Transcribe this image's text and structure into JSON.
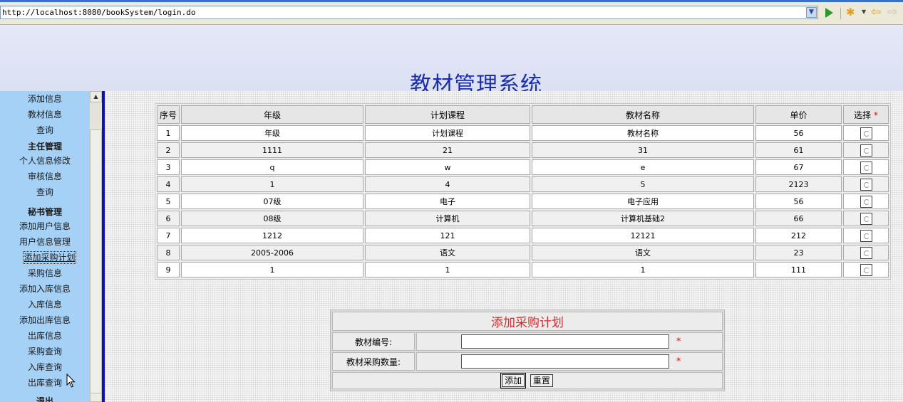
{
  "browser": {
    "url": "http://localhost:8080/bookSystem/login.do"
  },
  "header": {
    "title": "教材管理系统"
  },
  "sidebar": {
    "items": [
      {
        "label": "添加信息",
        "type": "link"
      },
      {
        "label": "教材信息",
        "type": "link"
      },
      {
        "label": "查询",
        "type": "link"
      },
      {
        "label": "主任管理",
        "type": "heading"
      },
      {
        "label": "个人信息修改",
        "type": "link"
      },
      {
        "label": "审核信息",
        "type": "link"
      },
      {
        "label": "查询",
        "type": "link"
      },
      {
        "label": "秘书管理",
        "type": "heading"
      },
      {
        "label": "添加用户信息",
        "type": "link"
      },
      {
        "label": "用户信息管理",
        "type": "link"
      },
      {
        "label": "添加采购计划",
        "type": "link",
        "selected": true
      },
      {
        "label": "采购信息",
        "type": "link"
      },
      {
        "label": "添加入库信息",
        "type": "link"
      },
      {
        "label": "入库信息",
        "type": "link"
      },
      {
        "label": "添加出库信息",
        "type": "link"
      },
      {
        "label": "出库信息",
        "type": "link"
      },
      {
        "label": "采购查询",
        "type": "link"
      },
      {
        "label": "入库查询",
        "type": "link"
      },
      {
        "label": "出库查询",
        "type": "link"
      },
      {
        "label": "退出",
        "type": "heading"
      }
    ]
  },
  "table": {
    "columns": [
      "序号",
      "年级",
      "计划课程",
      "教材名称",
      "单价",
      "选择"
    ],
    "required_mark": "*",
    "rows": [
      [
        "1",
        "年级",
        "计划课程",
        "教材名称",
        "56"
      ],
      [
        "2",
        "1111",
        "21",
        "31",
        "61"
      ],
      [
        "3",
        "q",
        "w",
        "e",
        "67"
      ],
      [
        "4",
        "1",
        "4",
        "5",
        "2123"
      ],
      [
        "5",
        "07级",
        "电子",
        "电子应用",
        "56"
      ],
      [
        "6",
        "08级",
        "计算机",
        "计算机基础2",
        "66"
      ],
      [
        "7",
        "1212",
        "121",
        "12121",
        "212"
      ],
      [
        "8",
        "2005-2006",
        "语文",
        "语文",
        "23"
      ],
      [
        "9",
        "1",
        "1",
        "1",
        "111"
      ]
    ]
  },
  "form": {
    "title": "添加采购计划",
    "material_id_label": "教材编号:",
    "material_id_value": "",
    "quantity_label": "教材采购数量:",
    "quantity_value": "",
    "required_mark": "*",
    "add_button": "添加",
    "reset_button": "重置"
  },
  "colors": {
    "title": "#1d2fa8",
    "sidebar_bg": "#a5d1f7",
    "divider": "#0a10c8",
    "form_title": "#e02828",
    "required": "#d01010"
  }
}
